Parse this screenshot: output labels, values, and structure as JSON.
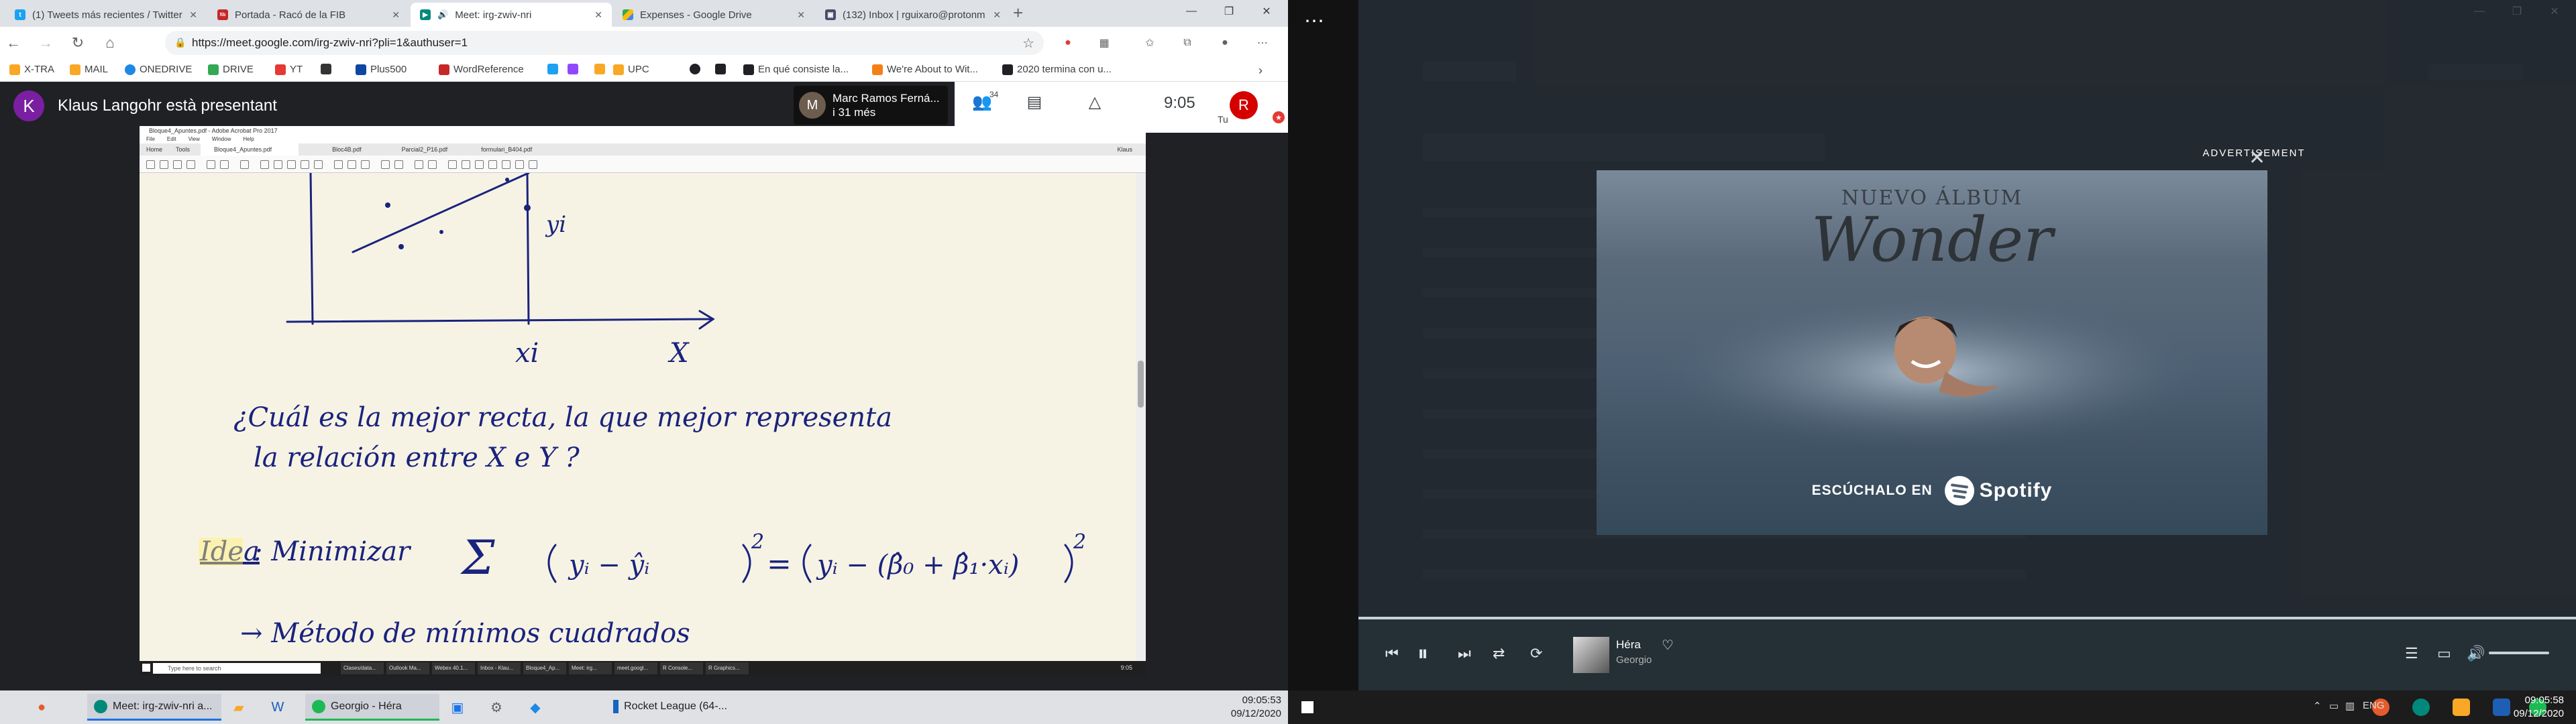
{
  "browser": {
    "tabs": [
      {
        "title": "(1) Tweets más recientes / Twitter",
        "fav_color": "#1da1f2",
        "fav_glyph": "t"
      },
      {
        "title": "Portada - Racó de la FIB",
        "fav_color": "#c62828",
        "fav_glyph": "fib"
      },
      {
        "title": "Meet: irg-zwiv-nri",
        "fav_color": "#00897b",
        "fav_glyph": "m"
      },
      {
        "title": "Expenses - Google Drive",
        "fav_color": "#fbbc04",
        "fav_glyph": "d"
      },
      {
        "title": "(132) Inbox | rguixaro@protonm...",
        "fav_color": "#4a4a6a",
        "fav_glyph": "p"
      }
    ],
    "url": "https://meet.google.com/irg-zwiv-nri?pli=1&authuser=1",
    "bookmarks": [
      {
        "label": "X-TRA",
        "color": "#f9a825"
      },
      {
        "label": "MAIL",
        "color": "#f9a825"
      },
      {
        "label": "ONEDRIVE",
        "color": "#1e88e5"
      },
      {
        "label": "DRIVE",
        "color": "#34a853"
      },
      {
        "label": "YT",
        "color": "#e53935"
      },
      {
        "label": "",
        "color": "#333333"
      },
      {
        "label": "Plus500",
        "color": "#0d47a1"
      },
      {
        "label": "WordReference",
        "color": "#c62828"
      },
      {
        "label": "",
        "color": "#1da1f2"
      },
      {
        "label": "",
        "color": "#9146ff"
      },
      {
        "label": "",
        "color": "#f9a825"
      },
      {
        "label": "UPC",
        "color": "#f9a825"
      },
      {
        "label": "",
        "color": "#202124"
      },
      {
        "label": "",
        "color": "#202124"
      },
      {
        "label": "En qué consiste la...",
        "color": "#202124"
      },
      {
        "label": "We're About to Wit...",
        "color": "#f57f17"
      },
      {
        "label": "2020 termina con u...",
        "color": "#202124"
      }
    ]
  },
  "meet": {
    "presenter_initial": "K",
    "presenter_text": "Klaus Langohr està presentant",
    "tile_initial": "M",
    "tile_name": "Marc Ramos Ferná...",
    "tile_extra": "i 31 més",
    "participants_count": "34",
    "time": "9:05",
    "self_initial": "R",
    "self_label": "Tu",
    "shared": {
      "title_bar": "Bloque4_Apuntes.pdf - Adobe Acrobat Pro 2017",
      "menu": [
        "File",
        "Edit",
        "View",
        "Window",
        "Help"
      ],
      "tabs": [
        "Home",
        "Tools",
        "Bloque4_Apuntes.pdf",
        "Bloc4B.pdf",
        "Parcial2_P16.pdf",
        "formulari_B404.pdf"
      ],
      "user": "Klaus",
      "note_question": "¿Cuál es la mejor recta, la que mejor representa",
      "note_question2": "la relación entre X e Y ?",
      "note_idea": "Idea",
      "note_min": ": Minimizar",
      "note_method": "→ Método de mínimos cuadrados",
      "axis_x": "X",
      "axis_xi": "xi",
      "axis_yi": "yi",
      "search_placeholder": "Type here to search",
      "apps": [
        "Clases/data...",
        "Outlook Ma...",
        "Webex 40.1...",
        "Inbox - Klau...",
        "Bloque4_Ap...",
        "Meet: irg...",
        "meet.googl...",
        "R Console...",
        "R Graphics..."
      ],
      "clock": "9:05"
    }
  },
  "taskbar_left": {
    "apps": [
      {
        "label": "Meet: irg-zwiv-nri a...",
        "color": "#00897b"
      },
      {
        "label": "Georgio - Héra",
        "color": "#1db954"
      },
      {
        "label": "Rocket League (64-...",
        "color": "#1565c0"
      }
    ],
    "time": "09:05:53",
    "date": "09/12/2020"
  },
  "spotify": {
    "ad_label": "ADVERTISEMENT",
    "ad_subtitle": "NUEVO ÁLBUM",
    "ad_title": "Wonder",
    "ad_cta": "ESCÚCHALO EN",
    "brand": "Spotify",
    "track": "Héra",
    "artist": "Georgio",
    "accent": "#1db954"
  },
  "taskbar_right": {
    "lang": "ENG",
    "time": "09:05:58",
    "date": "09/12/2020"
  }
}
